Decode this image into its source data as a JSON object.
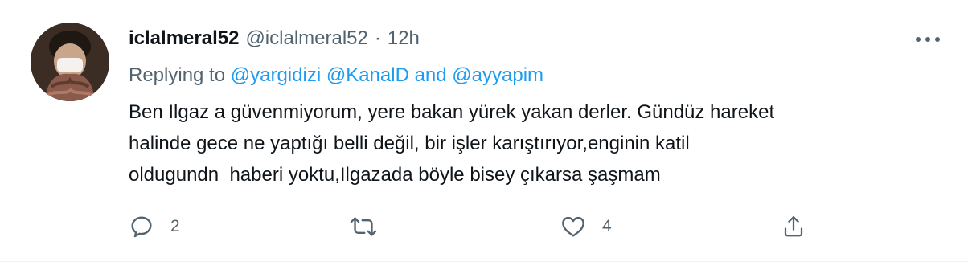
{
  "tweet": {
    "display_name": "iclalmeral52",
    "handle": "@iclalmeral52",
    "separator": "·",
    "time": "12h",
    "replying_prefix": "Replying to",
    "mentions": [
      "@yargidizi",
      "@KanalD",
      "@ayyapim"
    ],
    "replying_and": "and",
    "text_lines": [
      "Ben Ilgaz a güvenmiyorum, yere bakan yürek yakan derler. Gündüz hareket",
      "halinde gece ne yaptığı belli değil, bir işler karıştırıyor,enginin katil",
      "oldugundn  haberi yoktu,Ilgazada böyle bisey çıkarsa şaşmam"
    ]
  },
  "actions": {
    "reply": {
      "icon": "reply-icon",
      "count": "2"
    },
    "retweet": {
      "icon": "retweet-icon",
      "count": ""
    },
    "like": {
      "icon": "heart-icon",
      "count": "4"
    },
    "share": {
      "icon": "share-icon",
      "count": ""
    }
  },
  "colors": {
    "accent": "#1d9bf0",
    "secondary_text": "#536471",
    "primary_text": "#0f1419"
  }
}
